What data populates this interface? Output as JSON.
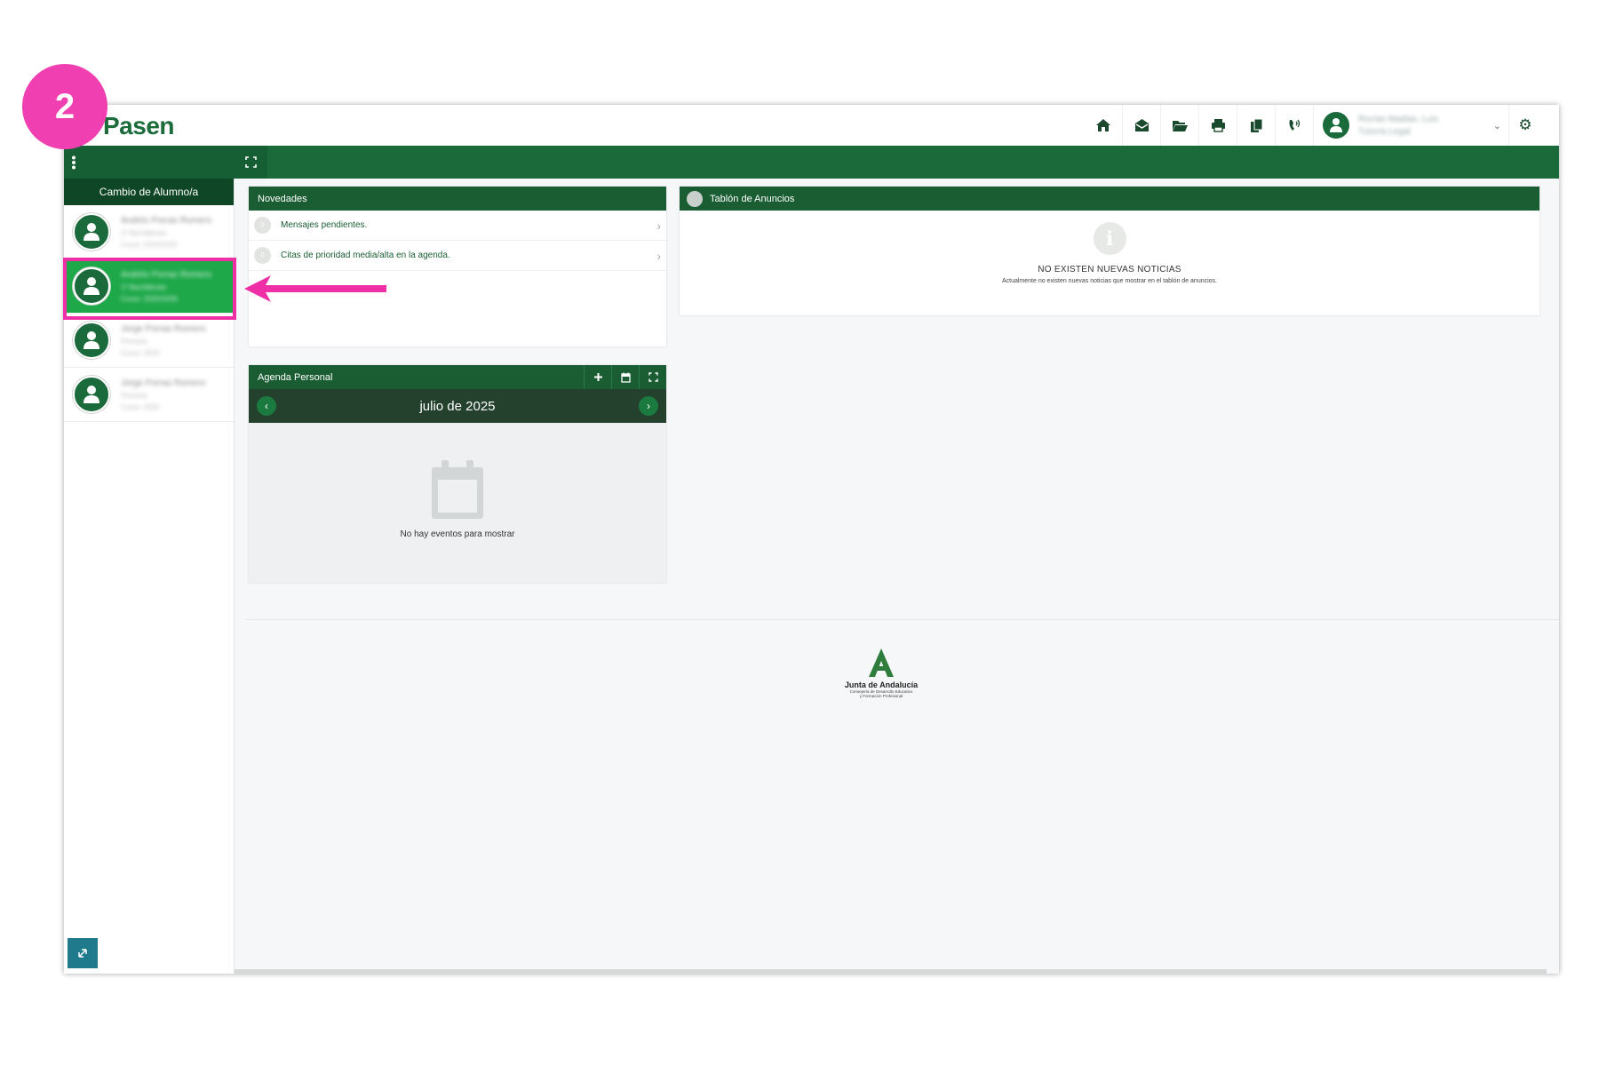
{
  "step_badge": "2",
  "app": {
    "logo": "Pasen"
  },
  "colors": {
    "brand_green": "#1a6a3a",
    "dark_green": "#0f4726",
    "active_green": "#1ea84a",
    "annotation_pink": "#ee2fa6"
  },
  "toolbar": {
    "icons": [
      "home-icon",
      "envelope-open-icon",
      "folder-open-icon",
      "print-icon",
      "copy-icon",
      "phone-volume-icon"
    ],
    "user_name": "Rocías Madias, Luis",
    "user_role": "Tutor/a Legal",
    "settings_icon": "gear-icon"
  },
  "sidebar": {
    "header": "Cambio de Alumno/a",
    "students": [
      {
        "name": "Andrés Porras Romero",
        "line1": "1º Bachillerato",
        "line2": "Curso: 2024/2025",
        "active": false
      },
      {
        "name": "Andrés Porras Romero",
        "line1": "1º Bachillerato",
        "line2": "Curso: 2025/2026",
        "active": true
      },
      {
        "name": "Jorge Porras Romero",
        "line1": "Primaria",
        "line2": "Curso: 2024",
        "active": false
      },
      {
        "name": "Jorge Porras Romero",
        "line1": "Primaria",
        "line2": "Curso: 2025",
        "active": false
      }
    ]
  },
  "novedades": {
    "title": "Novedades",
    "items": [
      {
        "count": "0",
        "label": "Mensajes pendientes."
      },
      {
        "count": "0",
        "label": "Citas de prioridad media/alta en la agenda."
      }
    ]
  },
  "tablon": {
    "title": "Tablón de Anuncios",
    "empty_title": "NO EXISTEN NUEVAS NOTICIAS",
    "empty_text": "Actualmente no existen nuevas noticias que mostrar en el tablón de anuncios."
  },
  "agenda": {
    "title": "Agenda Personal",
    "month": "julio de 2025",
    "empty": "No hay eventos para mostrar"
  },
  "footer": {
    "logo_letter": "A",
    "org": "Junta de Andalucía",
    "dept_line1": "Consejería de Desarrollo Educativo",
    "dept_line2": "y Formación Profesional"
  }
}
